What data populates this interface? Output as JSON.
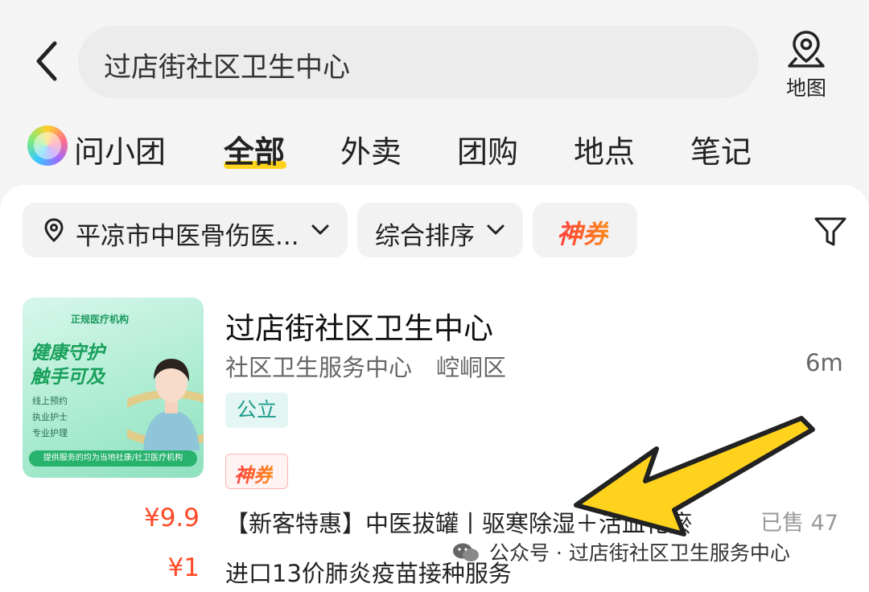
{
  "search": {
    "query": "过店街社区卫生中心",
    "map_label": "地图"
  },
  "tabs": {
    "ai_assistant": "问小团",
    "items": [
      "全部",
      "外卖",
      "团购",
      "地点",
      "笔记"
    ],
    "active": "全部"
  },
  "filters": {
    "location": "平凉市中医骨伤医...",
    "sort": "综合排序",
    "coupon": "神券"
  },
  "listing": {
    "thumbnail": {
      "tag": "正规医疗机构",
      "title_line1": "健康守护",
      "title_line2": "触手可及",
      "bullets": [
        "线上预约",
        "执业护士",
        "专业护理"
      ],
      "footer": "提供服务的均为当地社康/社卫医疗机构"
    },
    "name": "过店街社区卫生中心",
    "category": "社区卫生服务中心",
    "district": "崆峒区",
    "distance": "6m",
    "tag_public": "公立",
    "tag_coupon": "神券",
    "deals": [
      {
        "price": "¥9.9",
        "title": "【新客特惠】中医拔罐丨驱寒除湿＋活血化瘀",
        "sold": "已售 47"
      },
      {
        "price": "¥1",
        "title": "进口13价肺炎疫苗接种服务",
        "sold": ""
      }
    ]
  },
  "watermark": {
    "text": "公众号 · 过店街社区卫生服务中心"
  },
  "colors": {
    "accent_yellow": "#ffd21e",
    "price_red": "#ff4a26",
    "public_tag": "#1e9c8c"
  }
}
